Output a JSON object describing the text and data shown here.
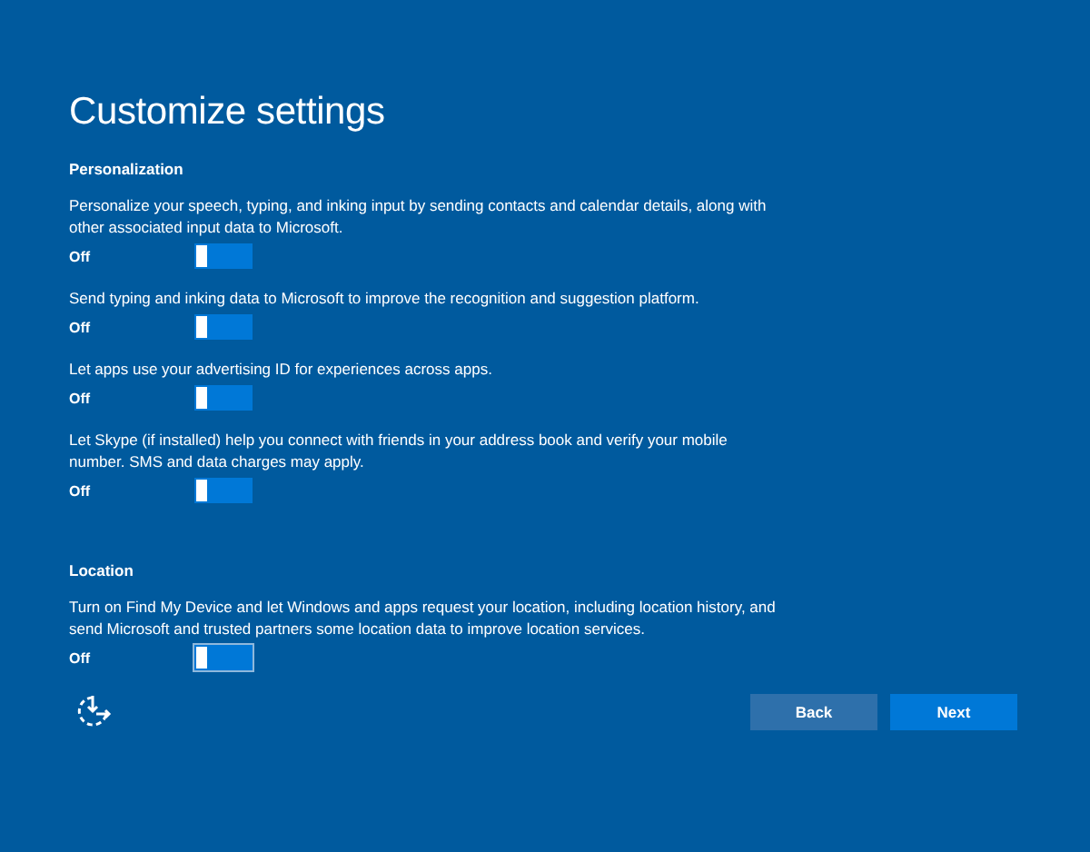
{
  "title": "Customize settings",
  "sections": [
    {
      "heading": "Personalization",
      "settings": [
        {
          "description": "Personalize your speech, typing, and inking input by sending contacts and calendar details, along with other associated input data to Microsoft.",
          "state_label": "Off",
          "on": false,
          "focused": false
        },
        {
          "description": "Send typing and inking data to Microsoft to improve the recognition and suggestion platform.",
          "state_label": "Off",
          "on": false,
          "focused": false
        },
        {
          "description": "Let apps use your advertising ID for experiences across apps.",
          "state_label": "Off",
          "on": false,
          "focused": false
        },
        {
          "description": "Let Skype (if installed) help you connect with friends in your address book and verify your mobile number. SMS and data charges may apply.",
          "state_label": "Off",
          "on": false,
          "focused": false
        }
      ]
    },
    {
      "heading": "Location",
      "settings": [
        {
          "description": "Turn on Find My Device and let Windows and apps request your location, including location history, and send Microsoft and trusted partners some location data to improve location services.",
          "state_label": "Off",
          "on": false,
          "focused": true
        }
      ]
    }
  ],
  "buttons": [
    {
      "label": "Back",
      "kind": "secondary"
    },
    {
      "label": "Next",
      "kind": "primary"
    }
  ]
}
